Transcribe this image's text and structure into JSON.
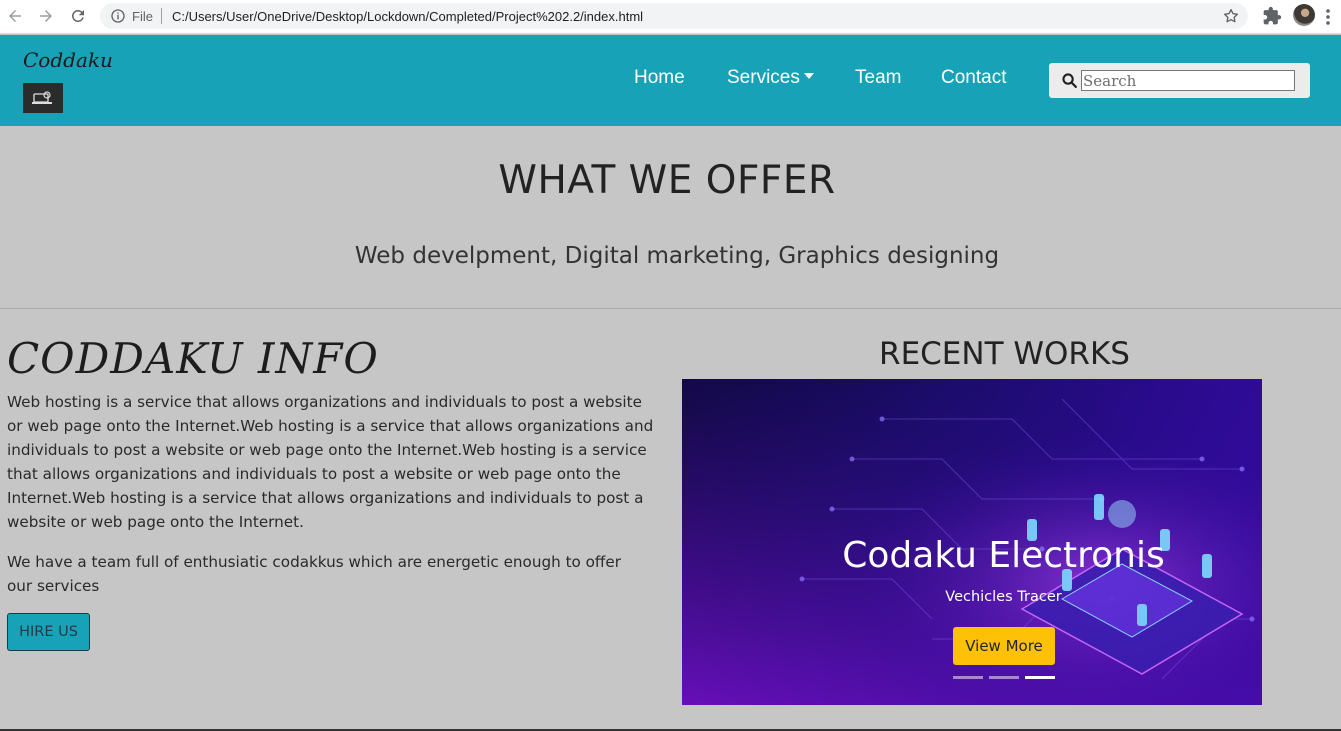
{
  "browser": {
    "file_label": "File",
    "url": "C:/Users/User/OneDrive/Desktop/Lockdown/Completed/Project%202.2/index.html"
  },
  "navbar": {
    "brand": "Coddaku",
    "links": [
      {
        "label": "Home"
      },
      {
        "label": "Services"
      },
      {
        "label": "Team"
      },
      {
        "label": "Contact"
      }
    ],
    "search_placeholder": "Search",
    "bg_color": "#17a2b8"
  },
  "offer": {
    "title": "WHAT WE OFFER",
    "subtitle": "Web develpment, Digital marketing, Graphics designing"
  },
  "info": {
    "heading": "CODDAKU INFO",
    "paragraph1": "Web hosting is a service that allows organizations and individuals to post a website or web page onto the Internet.Web hosting is a service that allows organizations and individuals to post a website or web page onto the Internet.Web hosting is a service that allows organizations and individuals to post a website or web page onto the Internet.Web hosting is a service that allows organizations and individuals to post a website or web page onto the Internet.",
    "paragraph2": "We have a team full of enthusiatic codakkus which are energetic enough to offer our services",
    "hire_button": "HIRE US"
  },
  "works": {
    "title": "RECENT WORKS",
    "slide_title": "Codaku Electronis",
    "slide_subtitle": "Vechicles Tracer",
    "view_more": "View More",
    "active_slide": 3,
    "total_slides": 3
  },
  "colors": {
    "accent": "#17a2b8",
    "button_yellow": "#ffc107",
    "page_bg": "#c6c6c6"
  }
}
